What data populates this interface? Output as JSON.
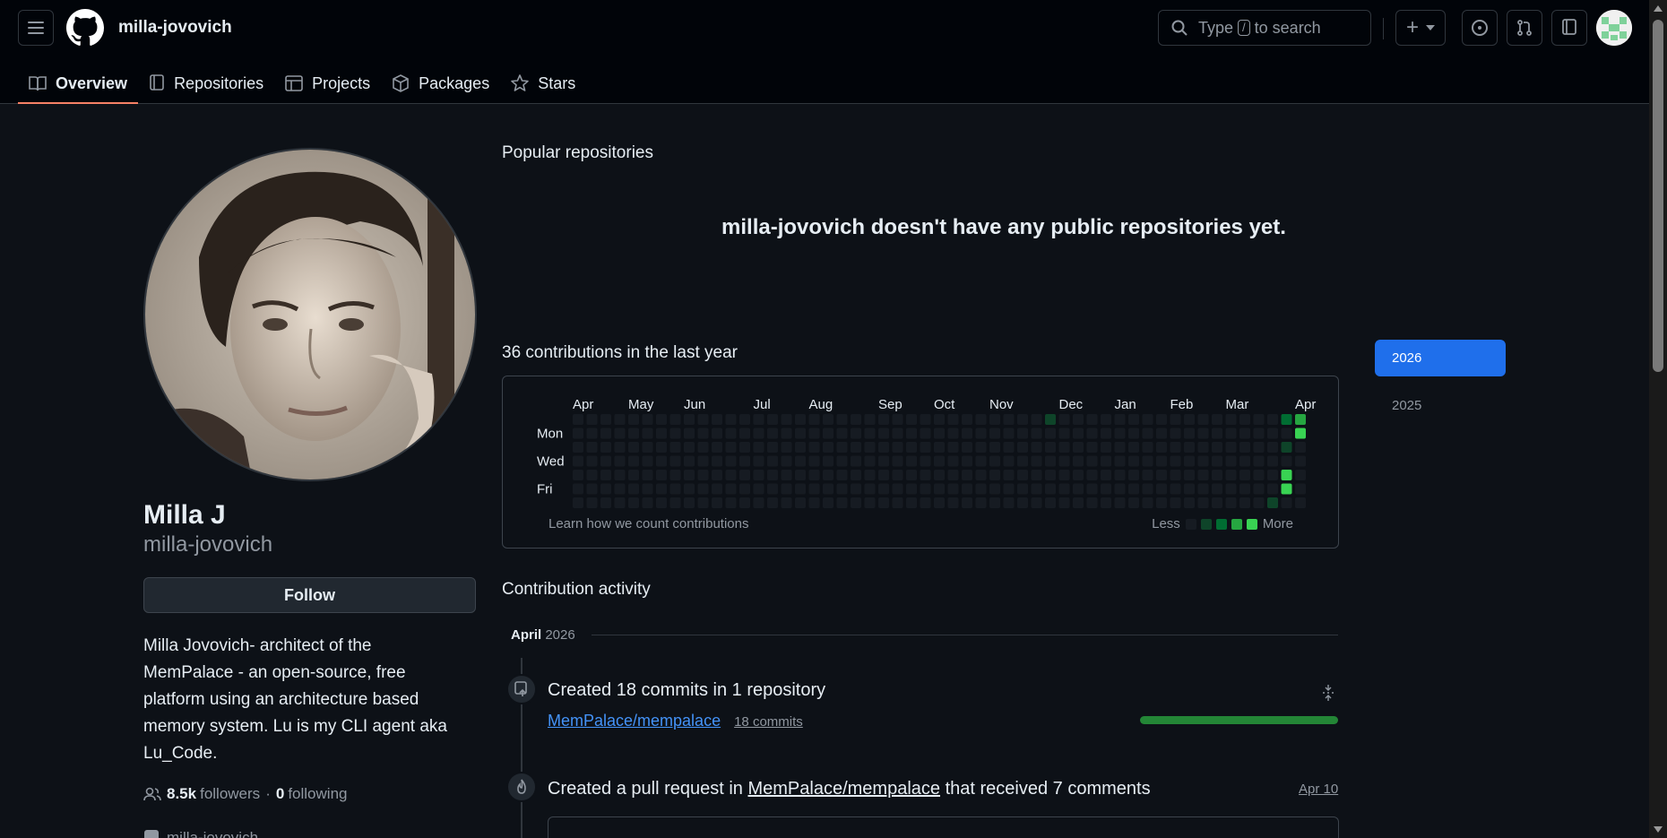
{
  "header": {
    "username": "milla-jovovich",
    "search_prefix": "Type",
    "search_key": "/",
    "search_suffix": "to search",
    "plus_label": "+"
  },
  "tabs": [
    {
      "label": "Overview",
      "icon": "book-icon"
    },
    {
      "label": "Repositories",
      "icon": "repo-icon"
    },
    {
      "label": "Projects",
      "icon": "table-icon"
    },
    {
      "label": "Packages",
      "icon": "package-icon"
    },
    {
      "label": "Stars",
      "icon": "star-icon"
    }
  ],
  "profile": {
    "name": "Milla J",
    "login": "milla-jovovich",
    "follow_label": "Follow",
    "bio_lines": [
      "Milla Jovovich- architect of the",
      "MemPalace - an open-source, free",
      "platform using an architecture based",
      "memory system. Lu is my CLI agent aka",
      "Lu_Code."
    ],
    "followers_count": "8.5k",
    "followers_label": "followers",
    "separator": "·",
    "following_count": "0",
    "following_label": "following",
    "extra_line": "milla-jovovich"
  },
  "popular": {
    "heading": "Popular repositories",
    "empty_message": "milla-jovovich doesn't have any public repositories yet."
  },
  "contributions": {
    "heading": "36 contributions in the last year",
    "months": [
      "Apr",
      "May",
      "Jun",
      "Jul",
      "Aug",
      "Sep",
      "Oct",
      "Nov",
      "Dec",
      "Jan",
      "Feb",
      "Mar",
      "Apr"
    ],
    "day_labels": [
      "Mon",
      "Wed",
      "Fri"
    ],
    "learn_link": "Learn how we count contributions",
    "legend_less": "Less",
    "legend_more": "More",
    "colors": [
      "#161b22",
      "#0e4429",
      "#006d32",
      "#26a641",
      "#39d353"
    ]
  },
  "years": {
    "selected": "2026",
    "other": "2025"
  },
  "activity": {
    "heading": "Contribution activity",
    "month": "April",
    "year": "2026",
    "item1_title": "Created 18 commits in 1 repository",
    "item1_repo": "MemPalace/mempalace",
    "item1_commits": "18 commits",
    "item2_prefix": "Created a pull request in",
    "item2_repo": "MemPalace/mempalace",
    "item2_suffix": "that received 7 comments",
    "item2_date": "Apr 10"
  }
}
